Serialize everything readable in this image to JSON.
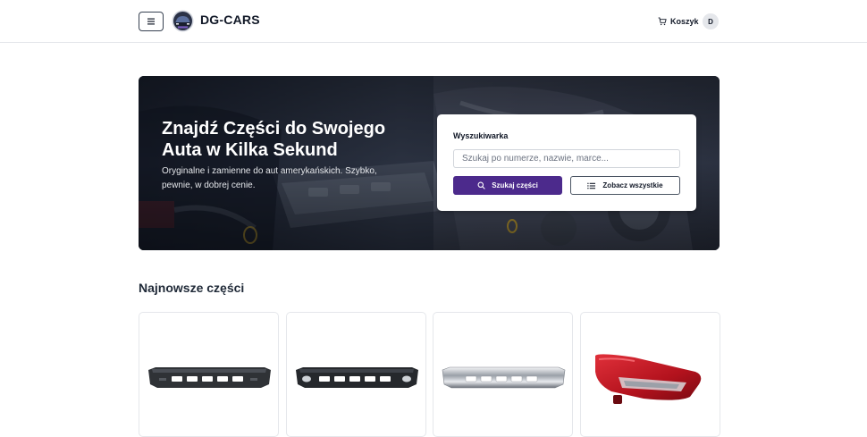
{
  "header": {
    "brand": "DG-CARS",
    "cart_label": "Koszyk",
    "avatar_initial": "D",
    "menu_icon": "hamburger-icon",
    "cart_icon": "cart-icon"
  },
  "hero": {
    "title": "Znajdź Części do Swojego Auta w Kilka Sekund",
    "subtitle": "Oryginalne i zamienne do aut amerykańskich. Szybko, pewnie, w dobrej cenie."
  },
  "search": {
    "label": "Wyszukiwarka",
    "placeholder": "Szukaj po numerze, nazwie, marce...",
    "value": "",
    "search_button": "Szukaj części",
    "view_all_button": "Zobacz wszystkie",
    "search_icon": "search-icon",
    "list_icon": "list-icon"
  },
  "section": {
    "title": "Najnowsze części"
  },
  "products": [
    {
      "image": "black-front-bumper"
    },
    {
      "image": "black-front-bumper-with-fog-lights"
    },
    {
      "image": "chrome-front-bumper"
    },
    {
      "image": "red-tail-light"
    }
  ],
  "colors": {
    "accent": "#4c2a8c",
    "border": "#e5e7eb",
    "text": "#111827"
  }
}
